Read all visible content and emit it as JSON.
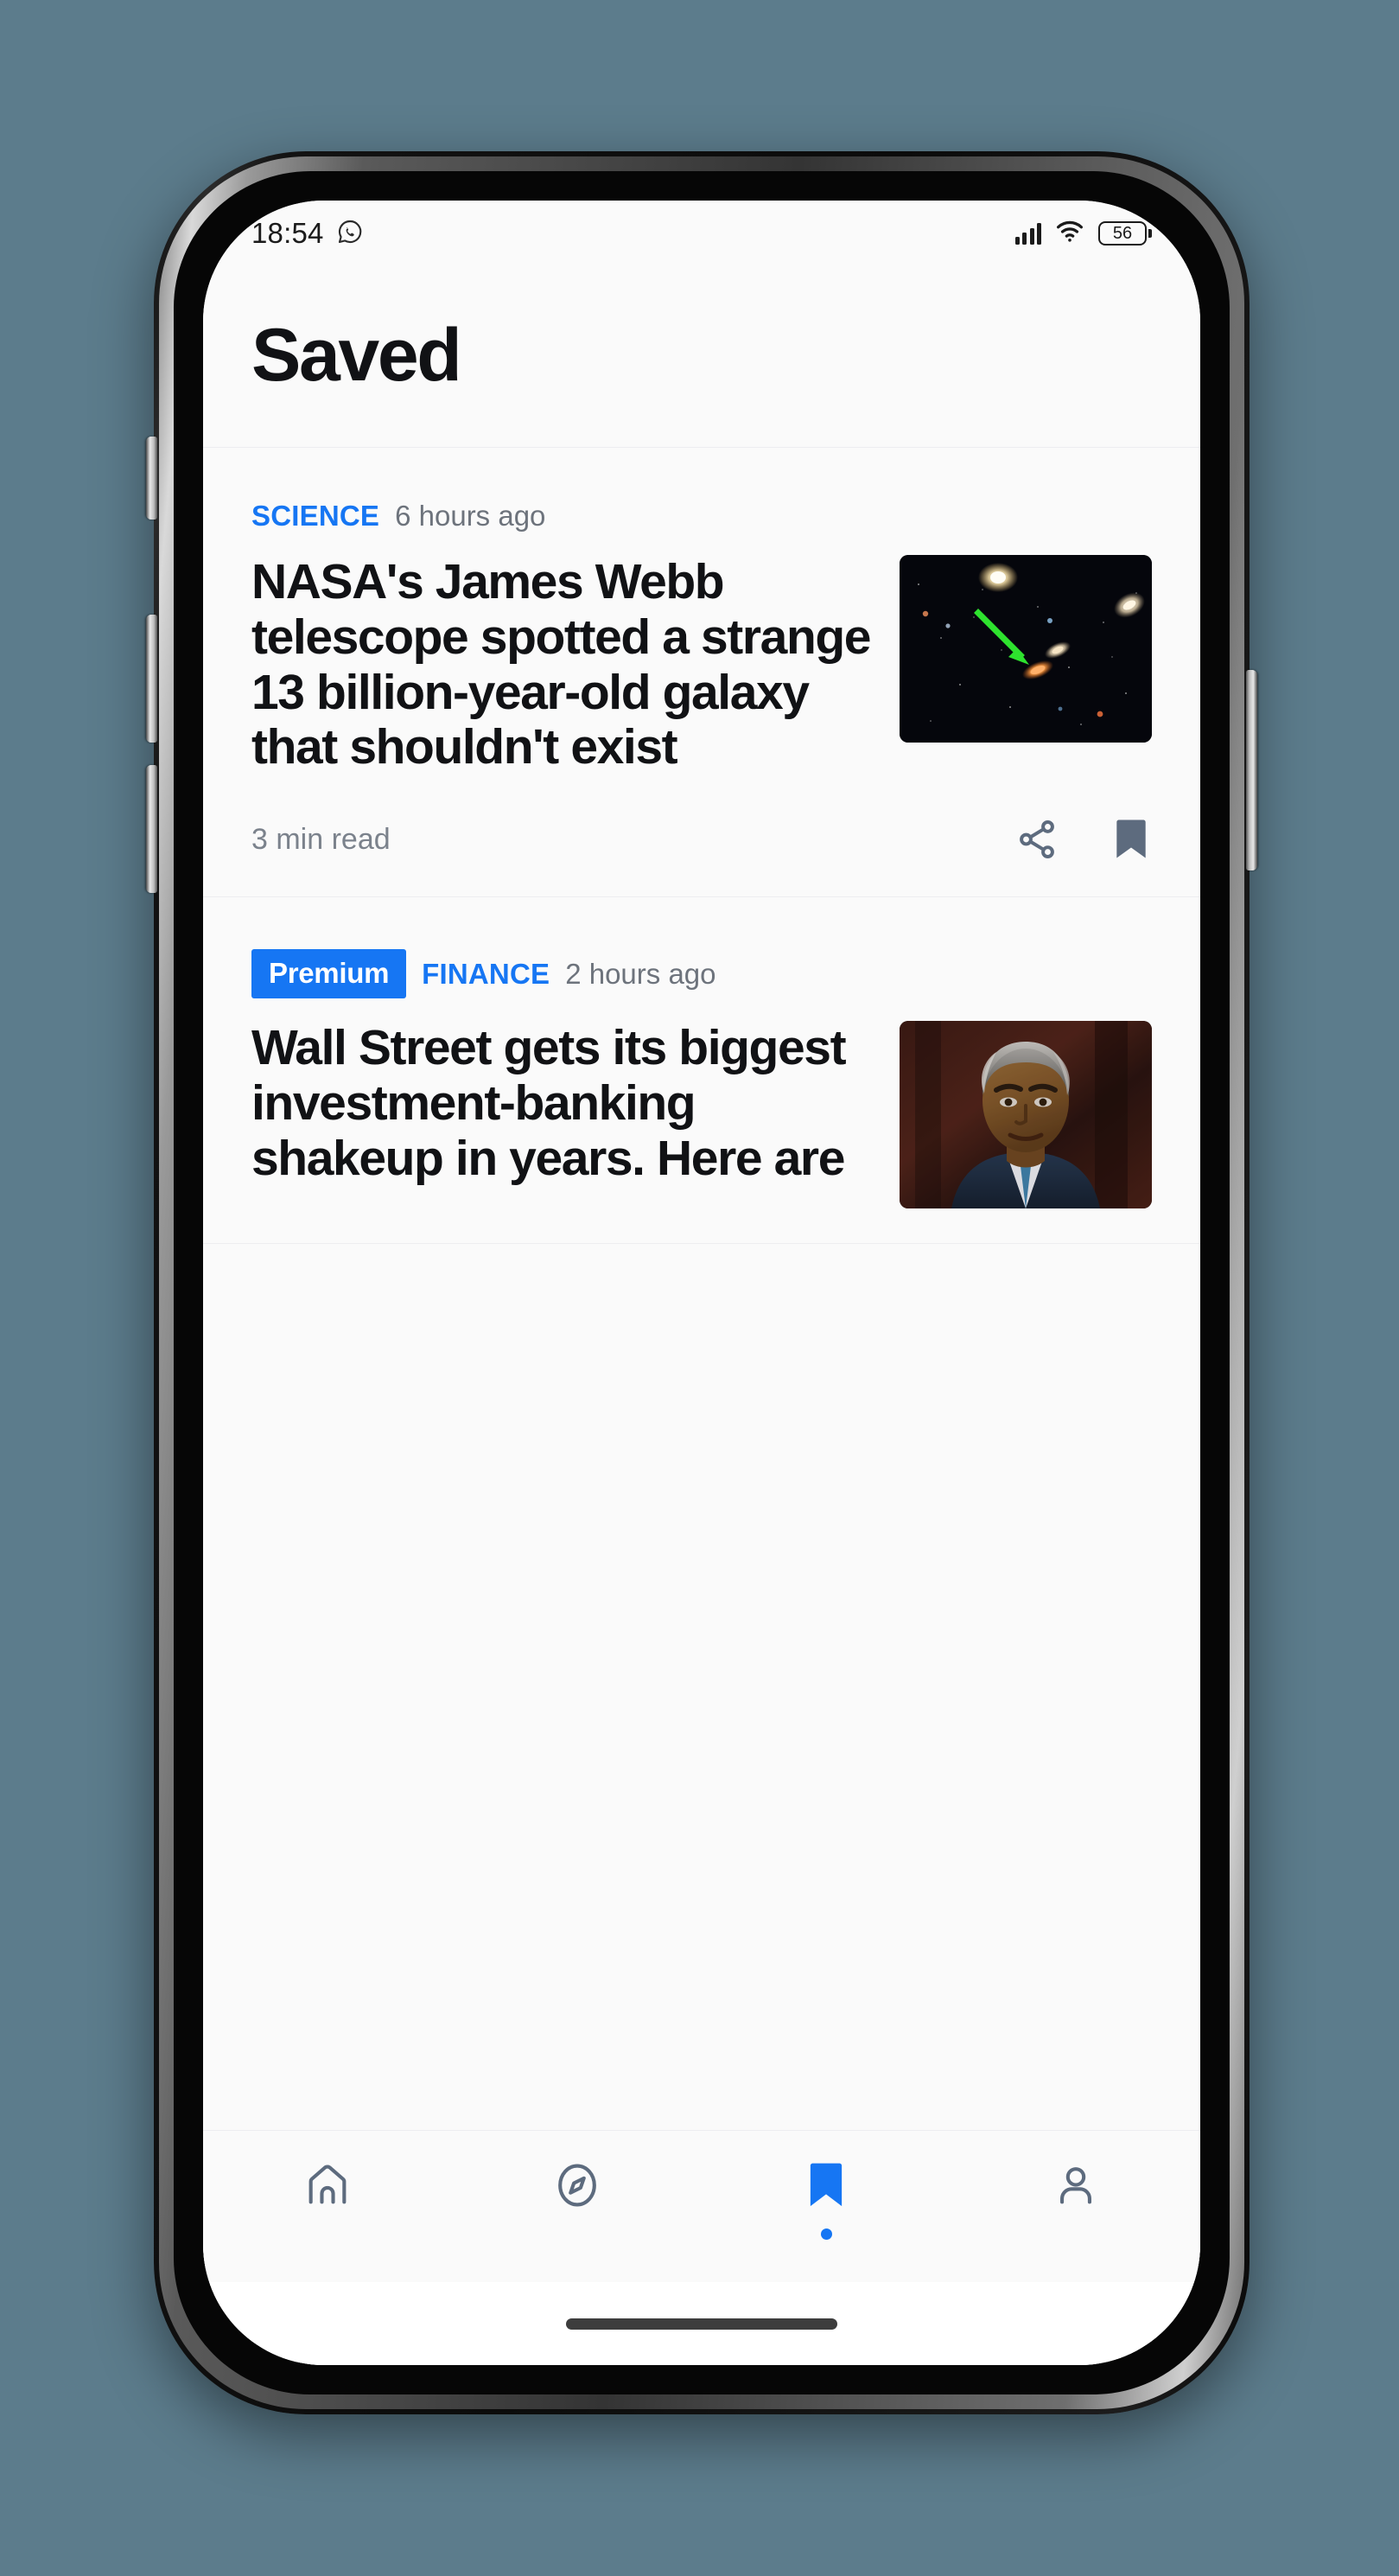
{
  "status_bar": {
    "time": "18:54",
    "app_icon": "whatsapp-icon",
    "signal_icon": "cellular-signal-icon",
    "wifi_icon": "wifi-icon",
    "battery_level": "56"
  },
  "header": {
    "title": "Saved"
  },
  "articles": [
    {
      "premium": false,
      "category": "SCIENCE",
      "time_ago": "6 hours ago",
      "headline": "NASA's James Webb telescope spotted a strange 13 billion-year-old galaxy that shouldn't exist",
      "read_time": "3 min read",
      "thumbnail": "deep-space-galaxy-photo",
      "share_icon": "share-icon",
      "bookmark_icon": "bookmark-filled-icon"
    },
    {
      "premium": true,
      "premium_label": "Premium",
      "category": "FINANCE",
      "time_ago": "2 hours ago",
      "headline": "Wall Street gets its biggest investment-banking shakeup in years. Here are",
      "thumbnail": "executive-portrait-photo"
    }
  ],
  "bottom_nav": {
    "items": [
      {
        "name": "home",
        "icon": "home-icon",
        "active": false
      },
      {
        "name": "explore",
        "icon": "compass-icon",
        "active": false
      },
      {
        "name": "saved",
        "icon": "bookmark-icon",
        "active": true
      },
      {
        "name": "profile",
        "icon": "person-icon",
        "active": false
      }
    ]
  },
  "colors": {
    "accent": "#1676f3",
    "background": "#fafafa",
    "text_primary": "#111215",
    "text_muted": "#6d737c",
    "icon_slate": "#5d6b7e",
    "wallpaper": "#5c7c8c"
  }
}
